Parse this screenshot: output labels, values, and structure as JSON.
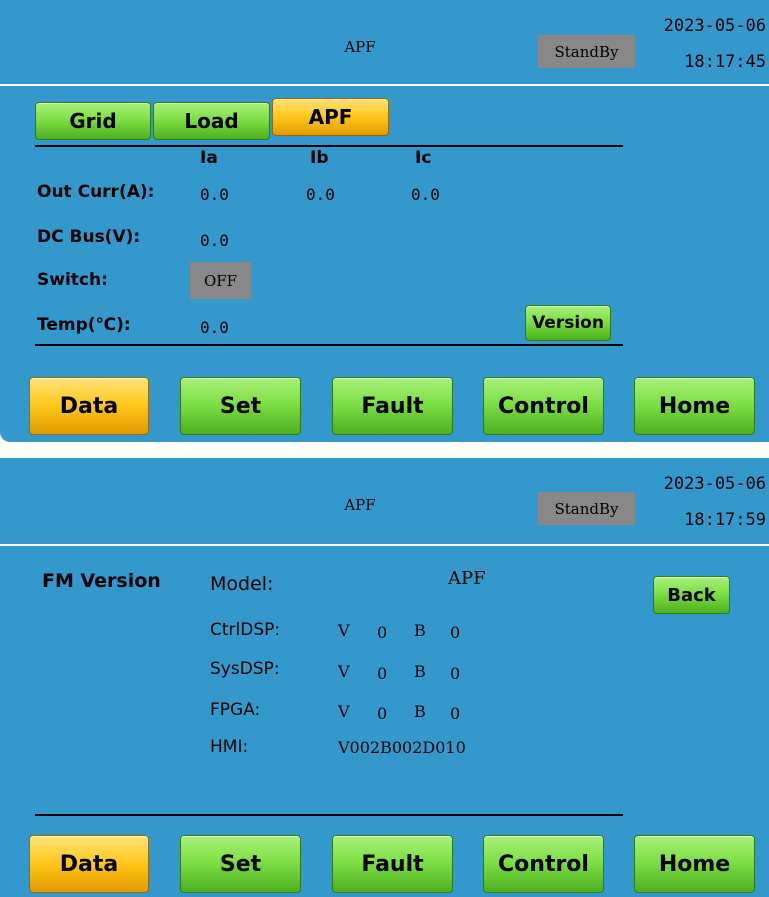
{
  "screens": [
    {
      "header": {
        "title": "APF",
        "status": "StandBy",
        "date": "2023-05-06",
        "time": "18:17:45"
      },
      "tabs": [
        {
          "label": "Grid",
          "active": false
        },
        {
          "label": "Load",
          "active": false
        },
        {
          "label": "APF",
          "active": true
        }
      ],
      "columns": [
        "Ia",
        "Ib",
        "Ic"
      ],
      "rows": {
        "out_curr": {
          "label": "Out Curr(A):",
          "values": [
            "0.0",
            "0.0",
            "0.0"
          ]
        },
        "dc_bus": {
          "label": "DC Bus(V):",
          "value": "0.0"
        },
        "switch": {
          "label": "Switch:",
          "value": "OFF"
        },
        "temp": {
          "label": "Temp(℃):",
          "value": "0.0"
        }
      },
      "version_button": "Version",
      "nav": [
        "Data",
        "Set",
        "Fault",
        "Control",
        "Home"
      ],
      "nav_active": "Data"
    },
    {
      "header": {
        "title": "APF",
        "status": "StandBy",
        "date": "2023-05-06",
        "time": "18:17:59"
      },
      "section_title": "FM Version",
      "back_button": "Back",
      "versions": {
        "model": {
          "label": "Model:",
          "value": "APF"
        },
        "ctrldsp": {
          "label": "CtrlDSP:",
          "v": "V",
          "v_num": "0",
          "b": "B",
          "b_num": "0"
        },
        "sysdsp": {
          "label": "SysDSP:",
          "v": "V",
          "v_num": "0",
          "b": "B",
          "b_num": "0"
        },
        "fpga": {
          "label": "FPGA:",
          "v": "V",
          "v_num": "0",
          "b": "B",
          "b_num": "0"
        },
        "hmi": {
          "label": "HMI:",
          "value": "V002B002D010"
        }
      },
      "nav": [
        "Data",
        "Set",
        "Fault",
        "Control",
        "Home"
      ],
      "nav_active": "Data"
    }
  ],
  "colors": {
    "background": "#3399cc",
    "button_green": "#7ee045",
    "button_active": "#ffc619",
    "status_box": "#888888"
  }
}
